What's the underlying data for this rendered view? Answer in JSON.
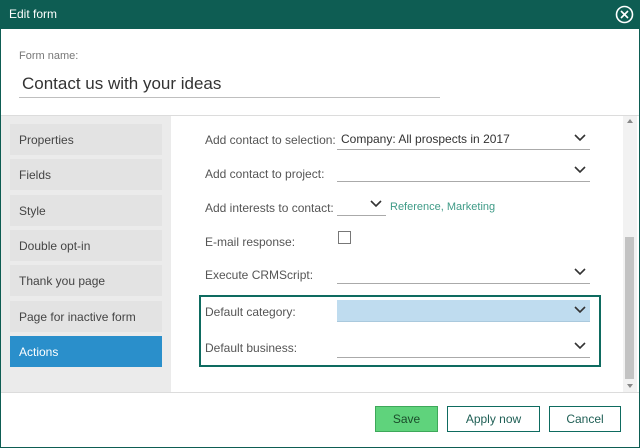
{
  "window": {
    "title": "Edit form",
    "close_icon": "close-circle-icon"
  },
  "form": {
    "name_label": "Form name:",
    "name_value": "Contact us with your ideas"
  },
  "sidebar": {
    "items": [
      {
        "label": "Properties"
      },
      {
        "label": "Fields"
      },
      {
        "label": "Style"
      },
      {
        "label": "Double opt-in"
      },
      {
        "label": "Thank you page"
      },
      {
        "label": "Page for inactive form"
      },
      {
        "label": "Actions",
        "active": true
      }
    ]
  },
  "actions": {
    "add_contact_selection": {
      "label": "Add contact to selection:",
      "value": "Company: All prospects in 2017"
    },
    "add_contact_project": {
      "label": "Add contact to project:",
      "value": ""
    },
    "add_interests": {
      "label": "Add interests to contact:",
      "value": "",
      "interests_text": "Reference, Marketing"
    },
    "email_response": {
      "label": "E-mail response:",
      "checked": false
    },
    "execute_crmscript": {
      "label": "Execute CRMScript:",
      "value": ""
    },
    "default_category": {
      "label": "Default category:",
      "value": ""
    },
    "default_business": {
      "label": "Default business:",
      "value": ""
    }
  },
  "buttons": {
    "save": "Save",
    "apply_now": "Apply now",
    "cancel": "Cancel"
  },
  "colors": {
    "header": "#0e5d53",
    "active_nav": "#2a8fcb",
    "save_button": "#5fd37c",
    "highlight_select": "#bfdcef",
    "link_text": "#3f9b87"
  }
}
